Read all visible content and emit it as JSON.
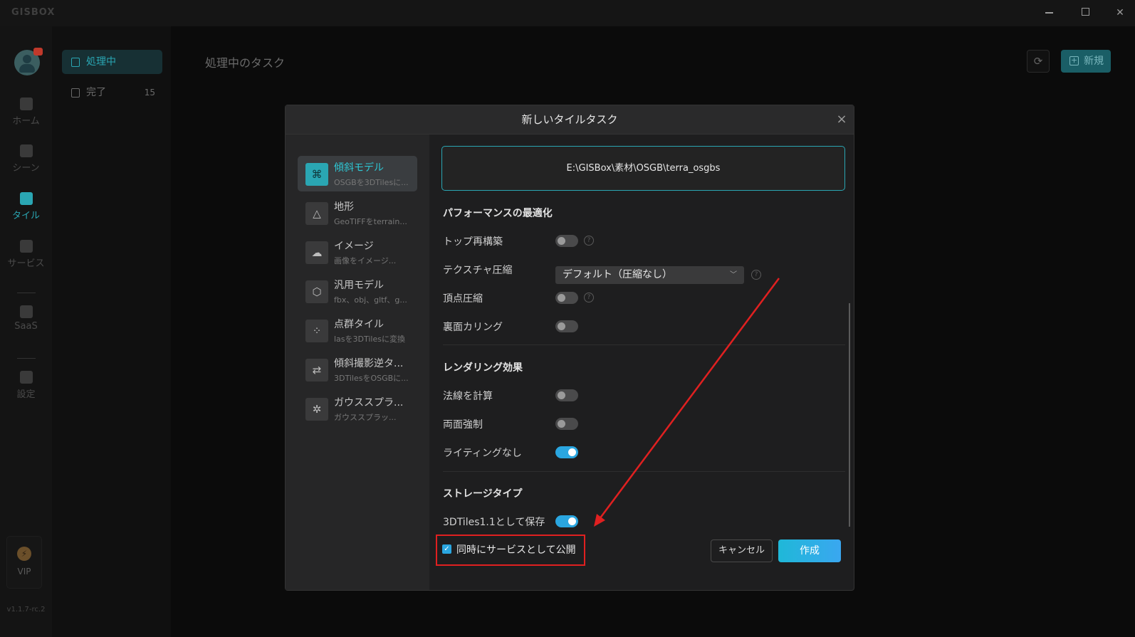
{
  "app": {
    "logo": "GISBOX",
    "version": "v1.1.7-rc.2"
  },
  "window": {
    "minimize_icon": "minimize-icon",
    "maximize_icon": "maximize-icon",
    "close_icon": "close-icon"
  },
  "leftnav": {
    "items": [
      {
        "label": "ホーム",
        "icon": "home-icon"
      },
      {
        "label": "シーン",
        "icon": "cube-icon"
      },
      {
        "label": "タイル",
        "icon": "tile-icon"
      },
      {
        "label": "サービス",
        "icon": "service-icon"
      },
      {
        "label": "SaaS",
        "icon": "lock-icon"
      },
      {
        "label": "設定",
        "icon": "gear-icon"
      }
    ],
    "vip": "VIP"
  },
  "subnav": {
    "processing": "処理中",
    "done": "完了",
    "done_count": "15"
  },
  "main": {
    "title": "処理中のタスク",
    "new_button": "新規"
  },
  "modal": {
    "title": "新しいタイルタスク",
    "categories": [
      {
        "name": "傾斜モデル",
        "desc": "OSGBを3DTilesに..."
      },
      {
        "name": "地形",
        "desc": "GeoTIFFをterrain..."
      },
      {
        "name": "イメージ",
        "desc": "画像をイメージ..."
      },
      {
        "name": "汎用モデル",
        "desc": "fbx、obj、gltf、g..."
      },
      {
        "name": "点群タイル",
        "desc": "lasを3DTilesに変換"
      },
      {
        "name": "傾斜撮影逆タ...",
        "desc": "3DTilesをOSGBに..."
      },
      {
        "name": "ガウススプラ...",
        "desc": "ガウススプラッ..."
      }
    ],
    "path": "E:\\GISBox\\素材\\OSGB\\terra_osgbs",
    "sections": {
      "performance": "パフォーマンスの最適化",
      "rendering": "レンダリング効果",
      "storage": "ストレージタイプ"
    },
    "options": {
      "top_rebuild": "トップ再構築",
      "texture_compression": "テクスチャ圧縮",
      "texture_value": "デフォルト（圧縮なし）",
      "vertex_compression": "頂点圧縮",
      "backface_culling": "裏面カリング",
      "compute_normals": "法線を計算",
      "double_sided": "両面強制",
      "no_lighting": "ライティングなし",
      "save_3dtiles11": "3DTiles1.1として保存"
    },
    "publish_service": "同時にサービスとして公開",
    "cancel": "キャンセル",
    "create": "作成"
  }
}
